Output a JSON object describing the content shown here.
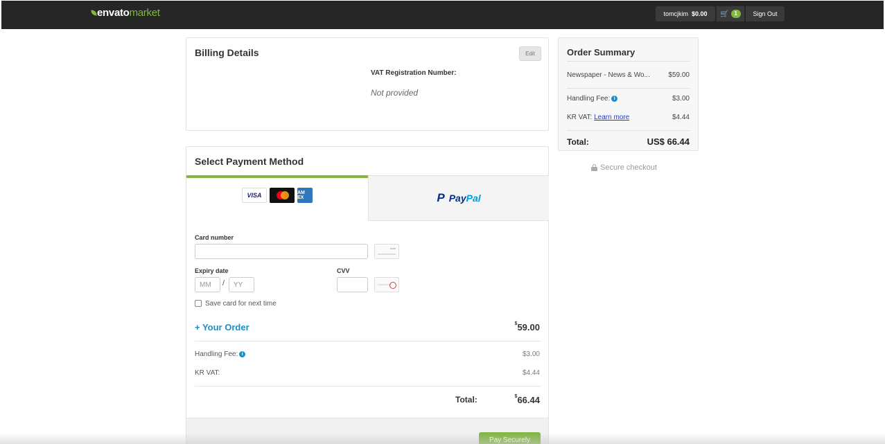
{
  "header": {
    "logo_envato": "envato",
    "logo_market": "market",
    "username": "tomcjkim",
    "balance": "$0.00",
    "cart_count": "1",
    "sign_out": "Sign Out"
  },
  "billing": {
    "title": "Billing Details",
    "edit": "Edit",
    "vat_label": "VAT Registration Number:",
    "vat_value": "Not provided"
  },
  "payment": {
    "title": "Select Payment Method",
    "tabs": {
      "card": {
        "visa": "VISA",
        "amex": "AM EX"
      },
      "paypal": {
        "pay": "Pay",
        "pal": "Pal"
      }
    },
    "card_number_label": "Card number",
    "card_number_value": "",
    "expiry_label": "Expiry date",
    "month_placeholder": "MM",
    "year_placeholder": "YY",
    "separator": "/",
    "cvv_label": "CVV",
    "cvv_value": "",
    "save_card_label": "Save card for next time",
    "save_card_checked": false,
    "your_order_label": "+ Your Order",
    "currency_symbol": "$",
    "order_amount": "59.00",
    "handling_fee_label": "Handling Fee:",
    "handling_fee_value": "$3.00",
    "vat_label": "KR VAT:",
    "vat_value": "$4.44",
    "total_label": "Total:",
    "total_value": "66.44",
    "pay_button": "Pay Securely"
  },
  "summary": {
    "title": "Order Summary",
    "item_name": "Newspaper - News & Wo...",
    "item_price": "$59.00",
    "handling_fee_label": "Handling Fee:",
    "handling_fee_value": "$3.00",
    "vat_label": "KR VAT:",
    "vat_link": "Learn more",
    "vat_value": "$4.44",
    "total_label": "Total:",
    "total_value": "US$ 66.44"
  },
  "secure_checkout": "Secure checkout",
  "colors": {
    "topbar": "#262626",
    "accent_green": "#82b541",
    "link_blue": "#1a8fc7"
  },
  "icons": [
    "envato-leaf-icon",
    "cart-icon",
    "info-icon",
    "lock-icon",
    "visa-icon",
    "mastercard-icon",
    "amex-icon",
    "paypal-icon",
    "card-glyph-icon",
    "cvv-glyph-icon"
  ]
}
